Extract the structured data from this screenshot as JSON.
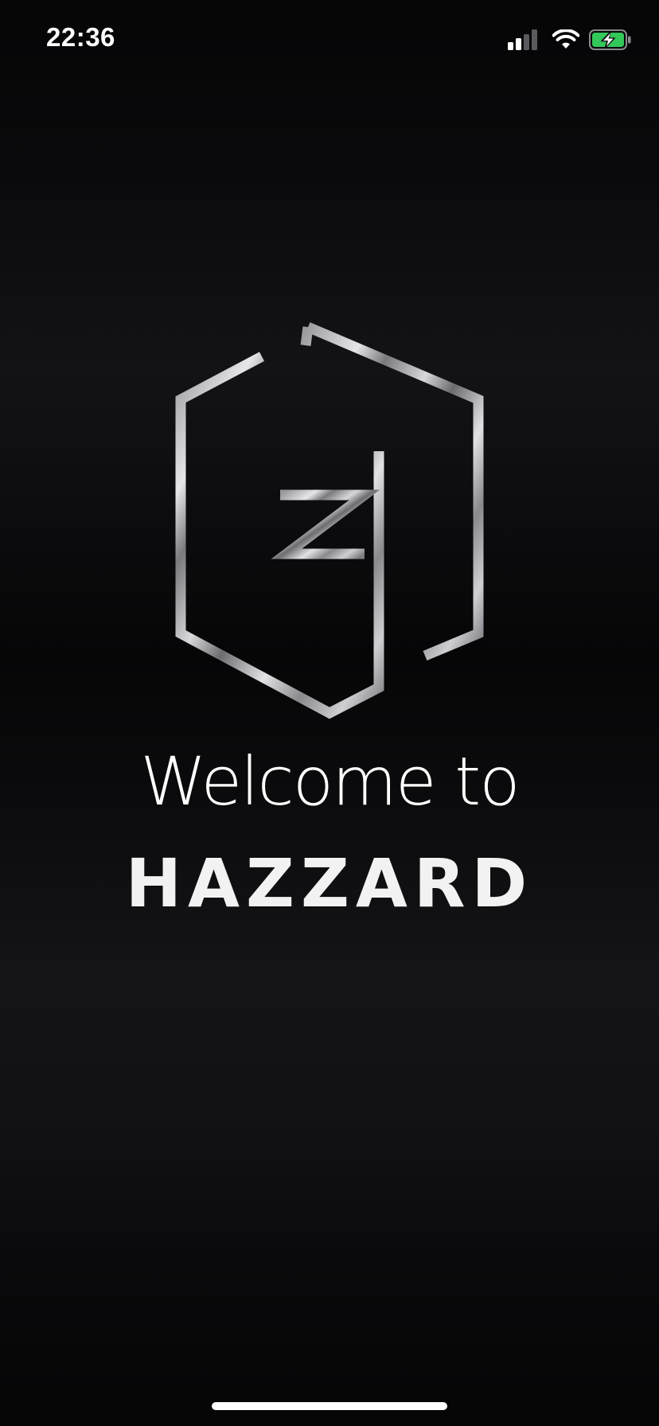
{
  "status_bar": {
    "time": "22:36",
    "icons": [
      "signal-icon",
      "wifi-icon",
      "battery-charging-icon"
    ],
    "battery_color": "#34c759"
  },
  "splash": {
    "logo_icon": "hazzard-hex-logo-icon",
    "welcome_text": "Welcome to",
    "brand_name": "HAZZARD"
  },
  "colors": {
    "background": "#0b0b0d",
    "text": "#ffffff",
    "logo_metal_light": "#e8e8ea",
    "logo_metal_dark": "#6e6e72"
  }
}
